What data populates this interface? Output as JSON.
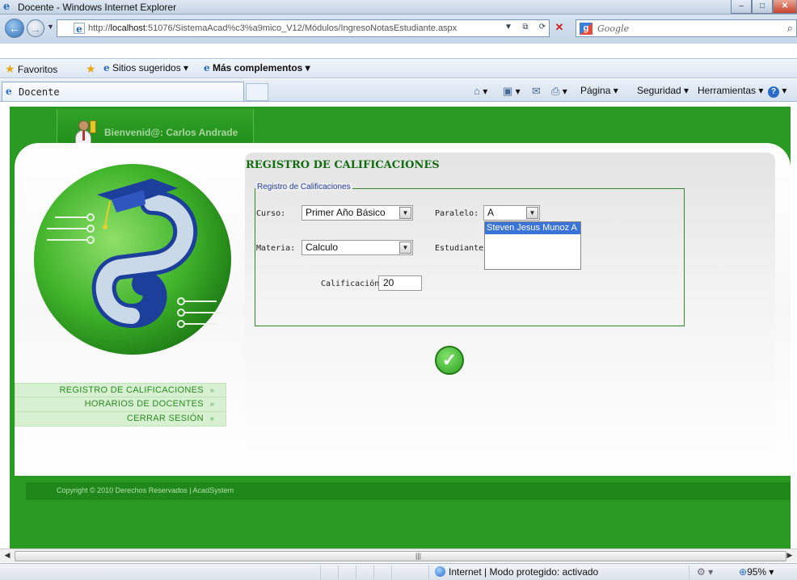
{
  "window": {
    "title": "Docente - Windows Internet Explorer",
    "buttons": {
      "minimize": "–",
      "maximize": "□",
      "close": "✕"
    }
  },
  "address": {
    "url_prefix": "http://",
    "url_host": "localhost",
    "url_rest": ":51076/SistemaAcad%c3%a9mico_V12/Módulos/IngresoNotasEstudiante.aspx",
    "search_placeholder": "Google"
  },
  "favorites": {
    "favorites_label": "Favoritos",
    "suggested_sites": "Sitios sugeridos ▾",
    "more_addons": "Más complementos ▾"
  },
  "tabs": {
    "active_tab": "Docente"
  },
  "command_bar": {
    "page": "Página ▾",
    "security": "Seguridad ▾",
    "tools": "Herramientas ▾"
  },
  "page": {
    "welcome": "Bienvenid@: Carlos Andrade",
    "form_title": "REGISTRO DE CALIFICACIONES",
    "legend": "Registro de Calificaciones",
    "labels": {
      "curso": "Curso:",
      "paralelo": "Paralelo:",
      "materia": "Materia:",
      "estudiante": "Estudiante:",
      "calificacion": "Calificación:"
    },
    "values": {
      "curso": "Primer Año Básico",
      "paralelo": "A",
      "materia": "Calculo",
      "calificacion": "20"
    },
    "students": [
      "Steven Jesus Munoz A"
    ],
    "menu": [
      {
        "label": "REGISTRO DE CALIFICACIONES"
      },
      {
        "label": "HORARIOS DE DOCENTES"
      },
      {
        "label": "CERRAR SESIÓN"
      }
    ],
    "footer": "Copyright © 2010 Derechos Reservados | AcadSystem"
  },
  "status": {
    "zone": "Internet | Modo protegido: activado",
    "zoom": "95%"
  },
  "colors": {
    "brand_green": "#2b9a23",
    "title_green": "#126b10",
    "legend_blue": "#2744a0",
    "selection_blue": "#3a74d6"
  },
  "icons": [
    "ie-logo-icon",
    "back-icon",
    "forward-icon",
    "refresh-icon",
    "stop-icon",
    "search-icon",
    "star-icon",
    "home-icon",
    "feeds-icon",
    "mail-icon",
    "print-icon",
    "help-icon",
    "checkmark-icon",
    "globe-icon",
    "zoom-icon"
  ]
}
